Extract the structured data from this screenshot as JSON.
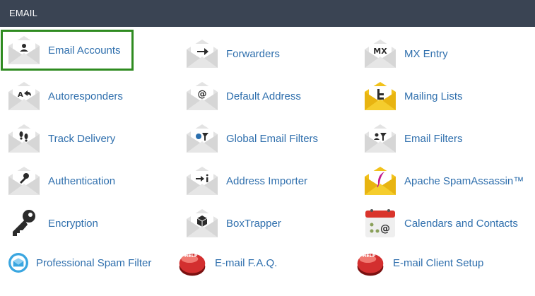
{
  "header": {
    "title": "EMAIL"
  },
  "items": [
    {
      "label": "Email Accounts",
      "icon": "envelope-user-icon"
    },
    {
      "label": "Forwarders",
      "icon": "envelope-arrow-right-icon"
    },
    {
      "label": "MX Entry",
      "icon": "envelope-mx-icon"
    },
    {
      "label": "Autoresponders",
      "icon": "envelope-autoreply-icon"
    },
    {
      "label": "Default Address",
      "icon": "envelope-at-icon"
    },
    {
      "label": "Mailing Lists",
      "icon": "envelope-list-icon"
    },
    {
      "label": "Track Delivery",
      "icon": "envelope-footprints-icon"
    },
    {
      "label": "Global Email Filters",
      "icon": "envelope-globe-filter-icon"
    },
    {
      "label": "Email Filters",
      "icon": "envelope-user-filter-icon"
    },
    {
      "label": "Authentication",
      "icon": "envelope-key-icon"
    },
    {
      "label": "Address Importer",
      "icon": "envelope-import-icon"
    },
    {
      "label": "Apache SpamAssassin™",
      "icon": "envelope-feather-icon"
    },
    {
      "label": "Encryption",
      "icon": "key-icon"
    },
    {
      "label": "BoxTrapper",
      "icon": "envelope-box-icon"
    },
    {
      "label": "Calendars and Contacts",
      "icon": "calendar-icon"
    },
    {
      "label": "Professional Spam Filter",
      "icon": "shield-envelope-icon"
    },
    {
      "label": "E-mail F.A.Q.",
      "icon": "help-button-icon"
    },
    {
      "label": "E-mail Client Setup",
      "icon": "help-button-icon"
    }
  ],
  "colors": {
    "header_bg": "#3a4453",
    "link": "#2f6fad",
    "highlight": "#2e8b20",
    "envelope": "#e6e6e6",
    "envelope_gold": "#f2c21b",
    "help_red": "#d32f2f"
  }
}
